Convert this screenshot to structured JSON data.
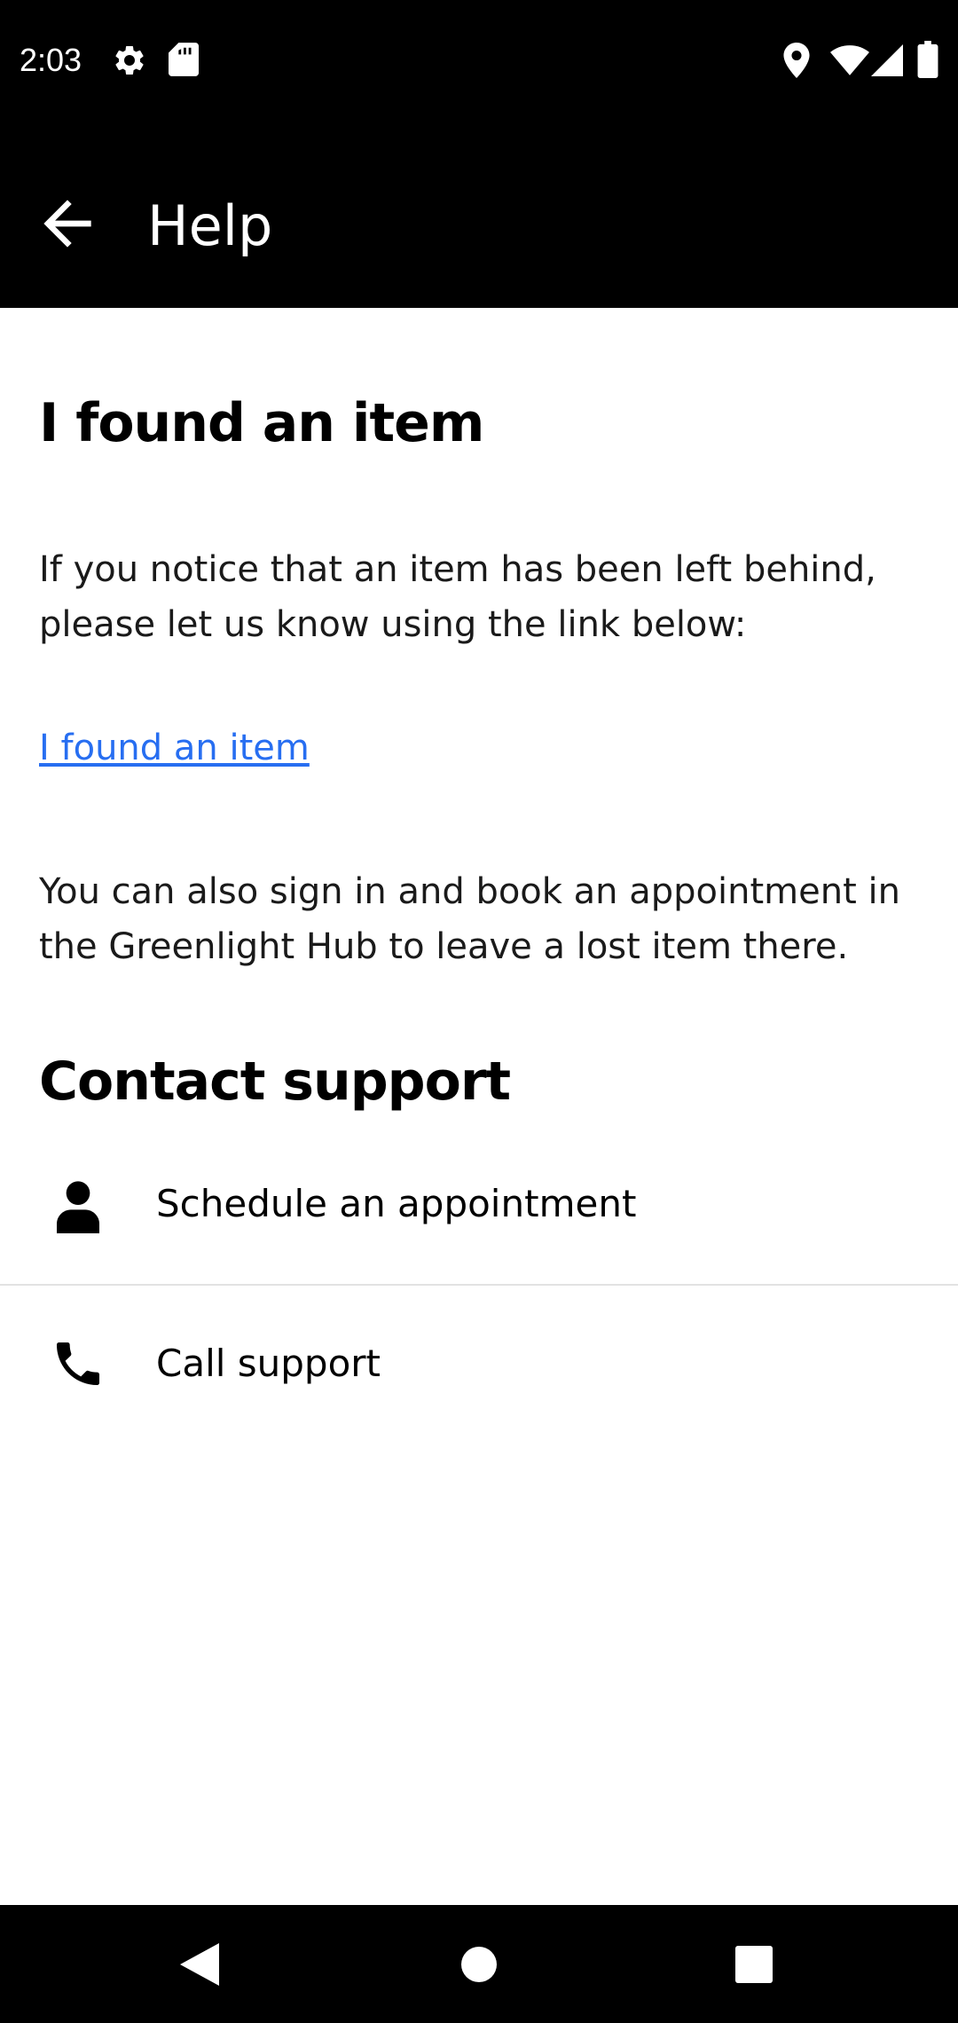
{
  "status_bar": {
    "time": "2:03",
    "icons": [
      "settings-icon",
      "sd-card-icon",
      "location-icon",
      "wifi-icon",
      "signal-icon",
      "battery-icon"
    ]
  },
  "app_bar": {
    "title": "Help",
    "back_icon": "arrow-left-icon"
  },
  "article": {
    "heading": "I found an item",
    "paragraph_1": "If you notice that an item has been left behind, please let us know using the link below:",
    "link_label": "I found an item",
    "paragraph_2": "You can also sign in and book an appointment in the Greenlight Hub to leave a lost item there."
  },
  "contact": {
    "heading": "Contact support",
    "items": [
      {
        "label": "Schedule an appointment",
        "icon": "person-icon"
      },
      {
        "label": "Call support",
        "icon": "phone-icon"
      }
    ]
  },
  "colors": {
    "link": "#276ef1",
    "bar_background": "#000000",
    "divider": "#e2e2e2"
  },
  "nav_bar": {
    "icons": [
      "nav-back-icon",
      "nav-home-icon",
      "nav-recents-icon"
    ]
  }
}
